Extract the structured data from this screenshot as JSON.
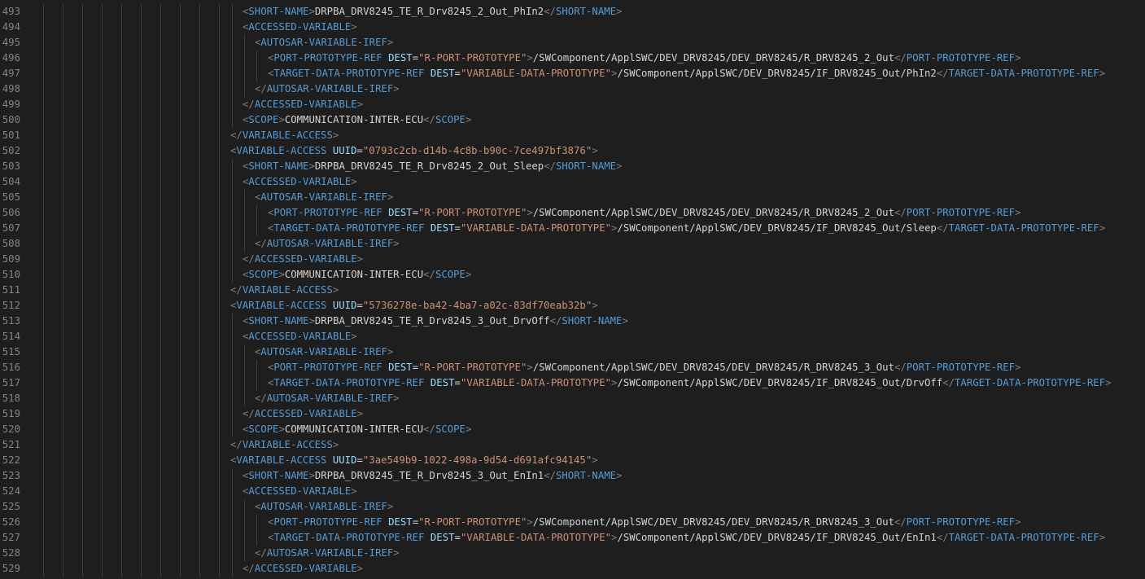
{
  "editor": {
    "colors": {
      "background": "#1e1e1e",
      "line_number": "#858585",
      "tag": "#569cd6",
      "punctuation": "#808080",
      "attribute": "#9cdcfe",
      "string": "#ce9178",
      "text": "#d4d4d4",
      "indent_guide": "#404040"
    },
    "lines": [
      {
        "num": "493",
        "indent": 3,
        "tokens": [
          [
            "p",
            "<"
          ],
          [
            "t",
            "SHORT-NAME"
          ],
          [
            "p",
            ">"
          ],
          [
            "x",
            "DRPBA_DRV8245_TE_R_Drv8245_2_Out_PhIn2"
          ],
          [
            "p",
            "</"
          ],
          [
            "t",
            "SHORT-NAME"
          ],
          [
            "p",
            ">"
          ]
        ]
      },
      {
        "num": "494",
        "indent": 3,
        "tokens": [
          [
            "p",
            "<"
          ],
          [
            "t",
            "ACCESSED-VARIABLE"
          ],
          [
            "p",
            ">"
          ]
        ]
      },
      {
        "num": "495",
        "indent": 4,
        "tokens": [
          [
            "p",
            "<"
          ],
          [
            "t",
            "AUTOSAR-VARIABLE-IREF"
          ],
          [
            "p",
            ">"
          ]
        ]
      },
      {
        "num": "496",
        "indent": 5,
        "tokens": [
          [
            "p",
            "<"
          ],
          [
            "t",
            "PORT-PROTOTYPE-REF"
          ],
          [
            "x",
            " "
          ],
          [
            "a",
            "DEST"
          ],
          [
            "x",
            "="
          ],
          [
            "v",
            "\"R-PORT-PROTOTYPE\""
          ],
          [
            "p",
            ">"
          ],
          [
            "x",
            "/SWComponent/ApplSWC/DEV_DRV8245/DEV_DRV8245/R_DRV8245_2_Out"
          ],
          [
            "p",
            "</"
          ],
          [
            "t",
            "PORT-PROTOTYPE-REF"
          ],
          [
            "p",
            ">"
          ]
        ]
      },
      {
        "num": "497",
        "indent": 5,
        "tokens": [
          [
            "p",
            "<"
          ],
          [
            "t",
            "TARGET-DATA-PROTOTYPE-REF"
          ],
          [
            "x",
            " "
          ],
          [
            "a",
            "DEST"
          ],
          [
            "x",
            "="
          ],
          [
            "v",
            "\"VARIABLE-DATA-PROTOTYPE\""
          ],
          [
            "p",
            ">"
          ],
          [
            "x",
            "/SWComponent/ApplSWC/DEV_DRV8245/IF_DRV8245_Out/PhIn2"
          ],
          [
            "p",
            "</"
          ],
          [
            "t",
            "TARGET-DATA-PROTOTYPE-REF"
          ],
          [
            "p",
            ">"
          ]
        ]
      },
      {
        "num": "498",
        "indent": 4,
        "tokens": [
          [
            "p",
            "</"
          ],
          [
            "t",
            "AUTOSAR-VARIABLE-IREF"
          ],
          [
            "p",
            ">"
          ]
        ]
      },
      {
        "num": "499",
        "indent": 3,
        "tokens": [
          [
            "p",
            "</"
          ],
          [
            "t",
            "ACCESSED-VARIABLE"
          ],
          [
            "p",
            ">"
          ]
        ]
      },
      {
        "num": "500",
        "indent": 3,
        "tokens": [
          [
            "p",
            "<"
          ],
          [
            "t",
            "SCOPE"
          ],
          [
            "p",
            ">"
          ],
          [
            "x",
            "COMMUNICATION-INTER-ECU"
          ],
          [
            "p",
            "</"
          ],
          [
            "t",
            "SCOPE"
          ],
          [
            "p",
            ">"
          ]
        ]
      },
      {
        "num": "501",
        "indent": 2,
        "tokens": [
          [
            "p",
            "</"
          ],
          [
            "t",
            "VARIABLE-ACCESS"
          ],
          [
            "p",
            ">"
          ]
        ]
      },
      {
        "num": "502",
        "indent": 2,
        "tokens": [
          [
            "p",
            "<"
          ],
          [
            "t",
            "VARIABLE-ACCESS"
          ],
          [
            "x",
            " "
          ],
          [
            "a",
            "UUID"
          ],
          [
            "x",
            "="
          ],
          [
            "v",
            "\"0793c2cb-d14b-4c8b-b90c-7ce497bf3876\""
          ],
          [
            "p",
            ">"
          ]
        ]
      },
      {
        "num": "503",
        "indent": 3,
        "tokens": [
          [
            "p",
            "<"
          ],
          [
            "t",
            "SHORT-NAME"
          ],
          [
            "p",
            ">"
          ],
          [
            "x",
            "DRPBA_DRV8245_TE_R_Drv8245_2_Out_Sleep"
          ],
          [
            "p",
            "</"
          ],
          [
            "t",
            "SHORT-NAME"
          ],
          [
            "p",
            ">"
          ]
        ]
      },
      {
        "num": "504",
        "indent": 3,
        "tokens": [
          [
            "p",
            "<"
          ],
          [
            "t",
            "ACCESSED-VARIABLE"
          ],
          [
            "p",
            ">"
          ]
        ]
      },
      {
        "num": "505",
        "indent": 4,
        "tokens": [
          [
            "p",
            "<"
          ],
          [
            "t",
            "AUTOSAR-VARIABLE-IREF"
          ],
          [
            "p",
            ">"
          ]
        ]
      },
      {
        "num": "506",
        "indent": 5,
        "tokens": [
          [
            "p",
            "<"
          ],
          [
            "t",
            "PORT-PROTOTYPE-REF"
          ],
          [
            "x",
            " "
          ],
          [
            "a",
            "DEST"
          ],
          [
            "x",
            "="
          ],
          [
            "v",
            "\"R-PORT-PROTOTYPE\""
          ],
          [
            "p",
            ">"
          ],
          [
            "x",
            "/SWComponent/ApplSWC/DEV_DRV8245/DEV_DRV8245/R_DRV8245_2_Out"
          ],
          [
            "p",
            "</"
          ],
          [
            "t",
            "PORT-PROTOTYPE-REF"
          ],
          [
            "p",
            ">"
          ]
        ]
      },
      {
        "num": "507",
        "indent": 5,
        "tokens": [
          [
            "p",
            "<"
          ],
          [
            "t",
            "TARGET-DATA-PROTOTYPE-REF"
          ],
          [
            "x",
            " "
          ],
          [
            "a",
            "DEST"
          ],
          [
            "x",
            "="
          ],
          [
            "v",
            "\"VARIABLE-DATA-PROTOTYPE\""
          ],
          [
            "p",
            ">"
          ],
          [
            "x",
            "/SWComponent/ApplSWC/DEV_DRV8245/IF_DRV8245_Out/Sleep"
          ],
          [
            "p",
            "</"
          ],
          [
            "t",
            "TARGET-DATA-PROTOTYPE-REF"
          ],
          [
            "p",
            ">"
          ]
        ]
      },
      {
        "num": "508",
        "indent": 4,
        "tokens": [
          [
            "p",
            "</"
          ],
          [
            "t",
            "AUTOSAR-VARIABLE-IREF"
          ],
          [
            "p",
            ">"
          ]
        ]
      },
      {
        "num": "509",
        "indent": 3,
        "tokens": [
          [
            "p",
            "</"
          ],
          [
            "t",
            "ACCESSED-VARIABLE"
          ],
          [
            "p",
            ">"
          ]
        ]
      },
      {
        "num": "510",
        "indent": 3,
        "tokens": [
          [
            "p",
            "<"
          ],
          [
            "t",
            "SCOPE"
          ],
          [
            "p",
            ">"
          ],
          [
            "x",
            "COMMUNICATION-INTER-ECU"
          ],
          [
            "p",
            "</"
          ],
          [
            "t",
            "SCOPE"
          ],
          [
            "p",
            ">"
          ]
        ]
      },
      {
        "num": "511",
        "indent": 2,
        "tokens": [
          [
            "p",
            "</"
          ],
          [
            "t",
            "VARIABLE-ACCESS"
          ],
          [
            "p",
            ">"
          ]
        ]
      },
      {
        "num": "512",
        "indent": 2,
        "tokens": [
          [
            "p",
            "<"
          ],
          [
            "t",
            "VARIABLE-ACCESS"
          ],
          [
            "x",
            " "
          ],
          [
            "a",
            "UUID"
          ],
          [
            "x",
            "="
          ],
          [
            "v",
            "\"5736278e-ba42-4ba7-a02c-83df70eab32b\""
          ],
          [
            "p",
            ">"
          ]
        ]
      },
      {
        "num": "513",
        "indent": 3,
        "tokens": [
          [
            "p",
            "<"
          ],
          [
            "t",
            "SHORT-NAME"
          ],
          [
            "p",
            ">"
          ],
          [
            "x",
            "DRPBA_DRV8245_TE_R_Drv8245_3_Out_DrvOff"
          ],
          [
            "p",
            "</"
          ],
          [
            "t",
            "SHORT-NAME"
          ],
          [
            "p",
            ">"
          ]
        ]
      },
      {
        "num": "514",
        "indent": 3,
        "tokens": [
          [
            "p",
            "<"
          ],
          [
            "t",
            "ACCESSED-VARIABLE"
          ],
          [
            "p",
            ">"
          ]
        ]
      },
      {
        "num": "515",
        "indent": 4,
        "tokens": [
          [
            "p",
            "<"
          ],
          [
            "t",
            "AUTOSAR-VARIABLE-IREF"
          ],
          [
            "p",
            ">"
          ]
        ]
      },
      {
        "num": "516",
        "indent": 5,
        "tokens": [
          [
            "p",
            "<"
          ],
          [
            "t",
            "PORT-PROTOTYPE-REF"
          ],
          [
            "x",
            " "
          ],
          [
            "a",
            "DEST"
          ],
          [
            "x",
            "="
          ],
          [
            "v",
            "\"R-PORT-PROTOTYPE\""
          ],
          [
            "p",
            ">"
          ],
          [
            "x",
            "/SWComponent/ApplSWC/DEV_DRV8245/DEV_DRV8245/R_DRV8245_3_Out"
          ],
          [
            "p",
            "</"
          ],
          [
            "t",
            "PORT-PROTOTYPE-REF"
          ],
          [
            "p",
            ">"
          ]
        ]
      },
      {
        "num": "517",
        "indent": 5,
        "tokens": [
          [
            "p",
            "<"
          ],
          [
            "t",
            "TARGET-DATA-PROTOTYPE-REF"
          ],
          [
            "x",
            " "
          ],
          [
            "a",
            "DEST"
          ],
          [
            "x",
            "="
          ],
          [
            "v",
            "\"VARIABLE-DATA-PROTOTYPE\""
          ],
          [
            "p",
            ">"
          ],
          [
            "x",
            "/SWComponent/ApplSWC/DEV_DRV8245/IF_DRV8245_Out/DrvOff"
          ],
          [
            "p",
            "</"
          ],
          [
            "t",
            "TARGET-DATA-PROTOTYPE-REF"
          ],
          [
            "p",
            ">"
          ]
        ]
      },
      {
        "num": "518",
        "indent": 4,
        "tokens": [
          [
            "p",
            "</"
          ],
          [
            "t",
            "AUTOSAR-VARIABLE-IREF"
          ],
          [
            "p",
            ">"
          ]
        ]
      },
      {
        "num": "519",
        "indent": 3,
        "tokens": [
          [
            "p",
            "</"
          ],
          [
            "t",
            "ACCESSED-VARIABLE"
          ],
          [
            "p",
            ">"
          ]
        ]
      },
      {
        "num": "520",
        "indent": 3,
        "tokens": [
          [
            "p",
            "<"
          ],
          [
            "t",
            "SCOPE"
          ],
          [
            "p",
            ">"
          ],
          [
            "x",
            "COMMUNICATION-INTER-ECU"
          ],
          [
            "p",
            "</"
          ],
          [
            "t",
            "SCOPE"
          ],
          [
            "p",
            ">"
          ]
        ]
      },
      {
        "num": "521",
        "indent": 2,
        "tokens": [
          [
            "p",
            "</"
          ],
          [
            "t",
            "VARIABLE-ACCESS"
          ],
          [
            "p",
            ">"
          ]
        ]
      },
      {
        "num": "522",
        "indent": 2,
        "tokens": [
          [
            "p",
            "<"
          ],
          [
            "t",
            "VARIABLE-ACCESS"
          ],
          [
            "x",
            " "
          ],
          [
            "a",
            "UUID"
          ],
          [
            "x",
            "="
          ],
          [
            "v",
            "\"3ae549b9-1022-498a-9d54-d691afc94145\""
          ],
          [
            "p",
            ">"
          ]
        ]
      },
      {
        "num": "523",
        "indent": 3,
        "tokens": [
          [
            "p",
            "<"
          ],
          [
            "t",
            "SHORT-NAME"
          ],
          [
            "p",
            ">"
          ],
          [
            "x",
            "DRPBA_DRV8245_TE_R_Drv8245_3_Out_EnIn1"
          ],
          [
            "p",
            "</"
          ],
          [
            "t",
            "SHORT-NAME"
          ],
          [
            "p",
            ">"
          ]
        ]
      },
      {
        "num": "524",
        "indent": 3,
        "tokens": [
          [
            "p",
            "<"
          ],
          [
            "t",
            "ACCESSED-VARIABLE"
          ],
          [
            "p",
            ">"
          ]
        ]
      },
      {
        "num": "525",
        "indent": 4,
        "tokens": [
          [
            "p",
            "<"
          ],
          [
            "t",
            "AUTOSAR-VARIABLE-IREF"
          ],
          [
            "p",
            ">"
          ]
        ]
      },
      {
        "num": "526",
        "indent": 5,
        "tokens": [
          [
            "p",
            "<"
          ],
          [
            "t",
            "PORT-PROTOTYPE-REF"
          ],
          [
            "x",
            " "
          ],
          [
            "a",
            "DEST"
          ],
          [
            "x",
            "="
          ],
          [
            "v",
            "\"R-PORT-PROTOTYPE\""
          ],
          [
            "p",
            ">"
          ],
          [
            "x",
            "/SWComponent/ApplSWC/DEV_DRV8245/DEV_DRV8245/R_DRV8245_3_Out"
          ],
          [
            "p",
            "</"
          ],
          [
            "t",
            "PORT-PROTOTYPE-REF"
          ],
          [
            "p",
            ">"
          ]
        ]
      },
      {
        "num": "527",
        "indent": 5,
        "tokens": [
          [
            "p",
            "<"
          ],
          [
            "t",
            "TARGET-DATA-PROTOTYPE-REF"
          ],
          [
            "x",
            " "
          ],
          [
            "a",
            "DEST"
          ],
          [
            "x",
            "="
          ],
          [
            "v",
            "\"VARIABLE-DATA-PROTOTYPE\""
          ],
          [
            "p",
            ">"
          ],
          [
            "x",
            "/SWComponent/ApplSWC/DEV_DRV8245/IF_DRV8245_Out/EnIn1"
          ],
          [
            "p",
            "</"
          ],
          [
            "t",
            "TARGET-DATA-PROTOTYPE-REF"
          ],
          [
            "p",
            ">"
          ]
        ]
      },
      {
        "num": "528",
        "indent": 4,
        "tokens": [
          [
            "p",
            "</"
          ],
          [
            "t",
            "AUTOSAR-VARIABLE-IREF"
          ],
          [
            "p",
            ">"
          ]
        ]
      },
      {
        "num": "529",
        "indent": 3,
        "tokens": [
          [
            "p",
            "</"
          ],
          [
            "t",
            "ACCESSED-VARIABLE"
          ],
          [
            "p",
            ">"
          ]
        ]
      }
    ]
  }
}
